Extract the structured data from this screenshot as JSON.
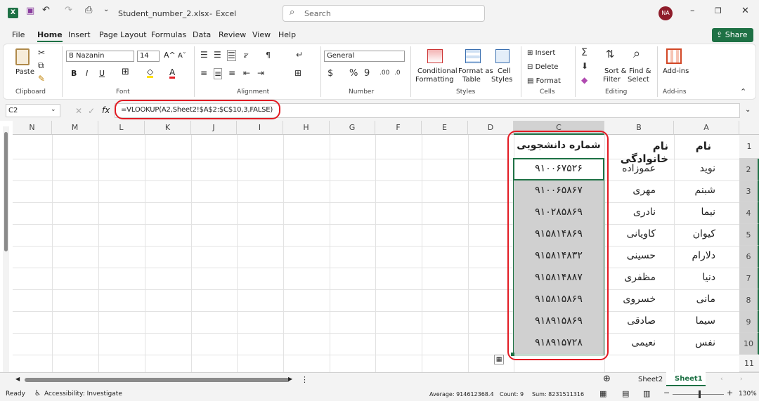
{
  "title": {
    "filename": "Student_number_2.xlsx",
    "app": "Excel",
    "search_placeholder": "Search",
    "avatar": "NA"
  },
  "menu": [
    "File",
    "Home",
    "Insert",
    "Page Layout",
    "Formulas",
    "Data",
    "Review",
    "View",
    "Help"
  ],
  "share": "Share",
  "ribbon": {
    "paste": "Paste",
    "clipboard": "Clipboard",
    "font_name": "B Nazanin",
    "font_size": "14",
    "font": "Font",
    "alignment": "Alignment",
    "number_format": "General",
    "number": "Number",
    "conditional": "Conditional",
    "formatting": "Formatting",
    "format_as": "Format as",
    "table": "Table",
    "cell": "Cell",
    "styles": "Styles",
    "styles_label": "Styles",
    "insert": "Insert",
    "delete": "Delete",
    "format": "Format",
    "cells": "Cells",
    "sort": "Sort &",
    "filter": "Filter",
    "find": "Find &",
    "select": "Select",
    "editing": "Editing",
    "addins": "Add-ins",
    "addins_label": "Add-ins"
  },
  "formula": {
    "namebox": "C2",
    "fx": "fx",
    "text": "=VLOOKUP(A2,Sheet2!$A$2:$C$10,3,FALSE)"
  },
  "columns": [
    "N",
    "M",
    "L",
    "K",
    "J",
    "I",
    "H",
    "G",
    "F",
    "E",
    "D",
    "C",
    "B",
    "A"
  ],
  "rows": [
    "1",
    "2",
    "3",
    "4",
    "5",
    "6",
    "7",
    "8",
    "9",
    "10",
    "11"
  ],
  "headers": {
    "a": "نام",
    "b": "نام خانوادگی",
    "c": "شماره دانشجویی"
  },
  "data": [
    {
      "a": "نوید",
      "b": "عموزاده",
      "c": "۹۱۰۰۶۷۵۲۶"
    },
    {
      "a": "شبنم",
      "b": "مهری",
      "c": "۹۱۰۰۶۵۸۶۷"
    },
    {
      "a": "نیما",
      "b": "نادری",
      "c": "۹۱۰۲۸۵۸۶۹"
    },
    {
      "a": "کیوان",
      "b": "کاویانی",
      "c": "۹۱۵۸۱۴۸۶۹"
    },
    {
      "a": "دلارام",
      "b": "حسینی",
      "c": "۹۱۵۸۱۴۸۳۲"
    },
    {
      "a": "دنیا",
      "b": "مظفری",
      "c": "۹۱۵۸۱۴۸۸۷"
    },
    {
      "a": "مانی",
      "b": "خسروی",
      "c": "۹۱۵۸۱۵۸۶۹"
    },
    {
      "a": "سیما",
      "b": "صادقی",
      "c": "۹۱۸۹۱۵۸۶۹"
    },
    {
      "a": "نفس",
      "b": "نعیمی",
      "c": "۹۱۸۹۱۵۷۲۸"
    }
  ],
  "tabs": [
    "Sheet2",
    "Sheet1"
  ],
  "status": {
    "ready": "Ready",
    "accessibility": "Accessibility: Investigate",
    "average": "Average: 914612368.4",
    "count": "Count: 9",
    "sum": "Sum: 8231511316",
    "zoom": "130%"
  }
}
